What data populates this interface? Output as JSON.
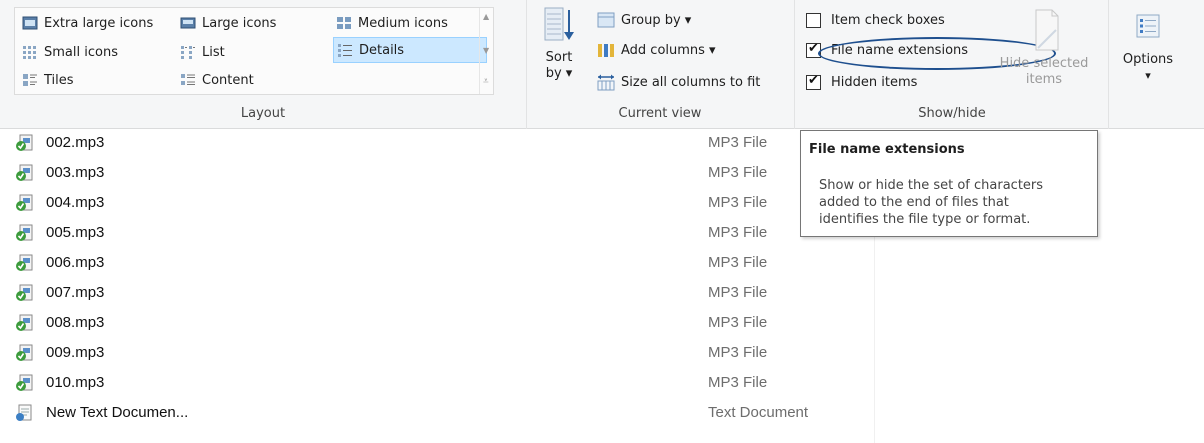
{
  "ribbon": {
    "layout": {
      "group_label": "Layout",
      "items": [
        {
          "label": "Extra large icons",
          "icon": "extra-large-icons-icon"
        },
        {
          "label": "Large icons",
          "icon": "large-icons-icon"
        },
        {
          "label": "Medium icons",
          "icon": "medium-icons-icon"
        },
        {
          "label": "Small icons",
          "icon": "small-icons-icon"
        },
        {
          "label": "List",
          "icon": "list-icon"
        },
        {
          "label": "Details",
          "icon": "details-icon",
          "selected": true
        },
        {
          "label": "Tiles",
          "icon": "tiles-icon"
        },
        {
          "label": "Content",
          "icon": "content-icon"
        }
      ]
    },
    "current_view": {
      "group_label": "Current view",
      "sort_label": "Sort",
      "sort_by_label": "by ▾",
      "group_by_label": "Group by ▾",
      "add_columns_label": "Add columns ▾",
      "size_columns_label": "Size all columns to fit"
    },
    "show_hide": {
      "group_label": "Show/hide",
      "item_check_boxes": {
        "label": "Item check boxes",
        "checked": false
      },
      "file_name_extensions": {
        "label": "File name extensions",
        "checked": true
      },
      "hidden_items": {
        "label": "Hidden items",
        "checked": true
      },
      "hide_selected_line1": "Hide selected",
      "hide_selected_line2": "items"
    },
    "options": {
      "label": "Options",
      "arrow": "▾"
    }
  },
  "files": [
    {
      "name": "002.mp3",
      "type": "MP3 File",
      "icon": "mp3-file-icon"
    },
    {
      "name": "003.mp3",
      "type": "MP3 File",
      "icon": "mp3-file-icon"
    },
    {
      "name": "004.mp3",
      "type": "MP3 File",
      "icon": "mp3-file-icon"
    },
    {
      "name": "005.mp3",
      "type": "MP3 File",
      "icon": "mp3-file-icon"
    },
    {
      "name": "006.mp3",
      "type": "MP3 File",
      "icon": "mp3-file-icon"
    },
    {
      "name": "007.mp3",
      "type": "MP3 File",
      "icon": "mp3-file-icon"
    },
    {
      "name": "008.mp3",
      "type": "MP3 File",
      "icon": "mp3-file-icon"
    },
    {
      "name": "009.mp3",
      "type": "MP3 File",
      "icon": "mp3-file-icon"
    },
    {
      "name": "010.mp3",
      "type": "MP3 File",
      "icon": "mp3-file-icon"
    },
    {
      "name": "New Text Documen...",
      "type": "Text Document",
      "icon": "text-document-icon"
    }
  ],
  "tooltip": {
    "title": "File name extensions",
    "line1": "Show or hide the set of characters",
    "line2": "added to the end of files that",
    "line3": "identifies the file type or format."
  },
  "colors": {
    "selected_bg": "#cce8ff",
    "annotation_ellipse": "#1e4f8e",
    "file_type_text": "#6d6d6d"
  }
}
